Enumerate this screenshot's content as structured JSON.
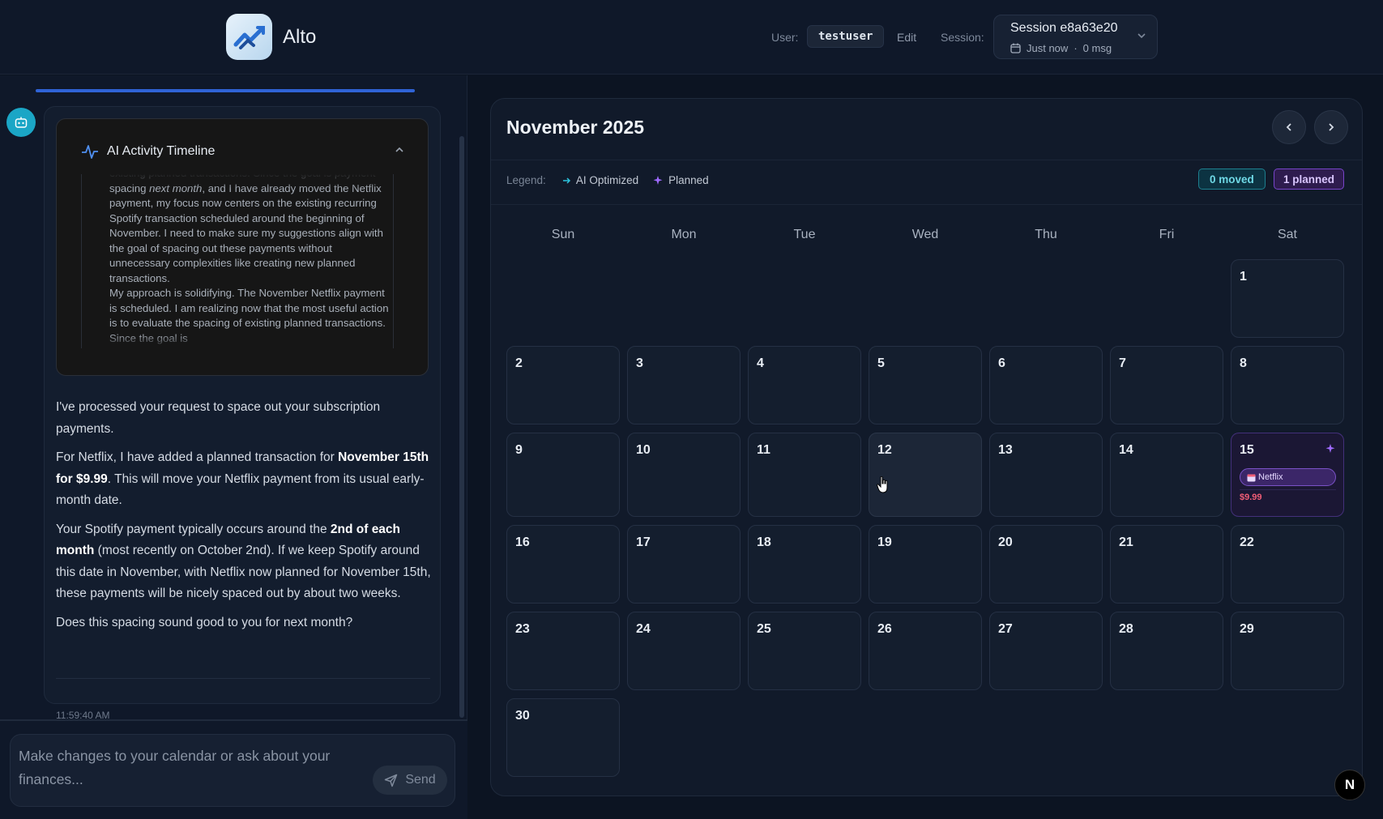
{
  "header": {
    "app_name": "Alto",
    "user_label": "User:",
    "username": "testuser",
    "edit_label": "Edit",
    "session_label": "Session:",
    "session_name": "Session e8a63e20",
    "session_time": "Just now",
    "session_sep": "·",
    "session_msgs": "0 msg"
  },
  "chat": {
    "timeline_title": "AI Activity Timeline",
    "timeline_text_a": "existing planned transactions. Since the goal is payment spacing ",
    "timeline_text_em": "next month",
    "timeline_text_b": ", and I have already moved the Netflix payment, my focus now centers on the existing recurring Spotify transaction scheduled around the beginning of November. I need to make sure my suggestions align with the goal of spacing out these payments without unnecessary complexities like creating new planned transactions.",
    "timeline_text_c": "My approach is solidifying. The November Netflix payment is scheduled. I am realizing now that the most useful action is to evaluate the spacing of existing planned transactions. Since the goal is",
    "p1": "I've processed your request to space out your subscription payments.",
    "p2_a": "For Netflix, I have added a planned transaction for ",
    "p2_b": "November 15th for $9.99",
    "p2_c": ". This will move your Netflix payment from its usual early-month date.",
    "p3_a": "Your Spotify payment typically occurs around the ",
    "p3_b": "2nd of each month",
    "p3_c": " (most recently on October 2nd). If we keep Spotify around this date in November, with Netflix now planned for November 15th, these payments will be nicely spaced out by about two weeks.",
    "p4": "Does this spacing sound good to you for next month?",
    "timestamp": "11:59:40 AM",
    "input_placeholder": "Make changes to your calendar or ask about your finances...",
    "send_label": "Send"
  },
  "calendar": {
    "month_title": "November 2025",
    "legend_label": "Legend:",
    "legend_ai": "AI Optimized",
    "legend_planned": "Planned",
    "badge_moved": "0 moved",
    "badge_planned": "1 planned",
    "weekdays": [
      "Sun",
      "Mon",
      "Tue",
      "Wed",
      "Thu",
      "Fri",
      "Sat"
    ],
    "first_weekday": 6,
    "days_in_month": 30,
    "hovered_day": 12,
    "planned_day": 15,
    "planned_event": {
      "name": "Netflix",
      "amount": "$9.99"
    },
    "colors": {
      "planned": "#7a52c7",
      "ai_optimized": "#2cc3dd",
      "expense": "#f05d76"
    }
  },
  "floating": {
    "n_badge": "N"
  }
}
